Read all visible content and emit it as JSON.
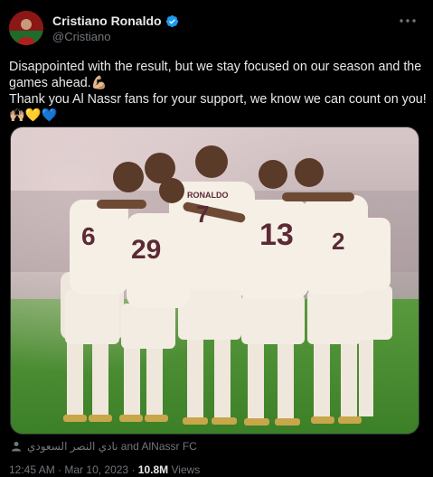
{
  "author": {
    "name": "Cristiano Ronaldo",
    "handle": "@Cristiano",
    "verified": true
  },
  "tweet": {
    "lines": [
      "Disappointed with the result, but we stay focused on our season and the games ahead.💪🏼",
      "Thank you Al Nassr fans for your support, we know we can count on you!",
      "🙌🏼💛💙"
    ]
  },
  "tagged": {
    "text": "نادي النصر السعودي and AlNassr FC"
  },
  "meta": {
    "time": "12:45 AM",
    "date": "Mar 10, 2023",
    "separator": "·",
    "views_count": "10.8M",
    "views_label": "Views"
  },
  "photo": {
    "jersey_name": "RONALDO",
    "jersey_numbers": [
      "6",
      "29",
      "7",
      "13",
      "2"
    ]
  },
  "colors": {
    "background": "#000000",
    "text": "#e7e9ea",
    "muted": "#71767b",
    "verified": "#1d9bf0",
    "pitch": "#3e8a2c"
  }
}
